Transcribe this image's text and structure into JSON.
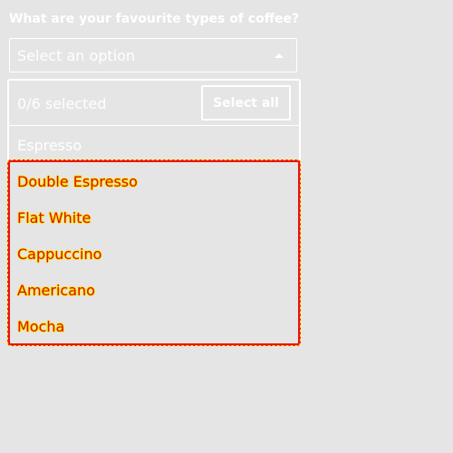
{
  "question": "What are your favourite types of coffee?",
  "select": {
    "placeholder": "Select an option",
    "caret_icon": "caret-up-icon"
  },
  "dropdown": {
    "selected_count": "0/6 selected",
    "select_all_label": "Select all",
    "options": [
      "Espresso",
      "Double Espresso",
      "Flat White",
      "Cappuccino",
      "Americano",
      "Mocha"
    ]
  },
  "colors": {
    "background": "#e5e5e5",
    "foreground": "#ffffff",
    "highlight_border": "#ee1111",
    "highlight_text": "#dd1111",
    "highlight_outline": "#f7e600"
  }
}
